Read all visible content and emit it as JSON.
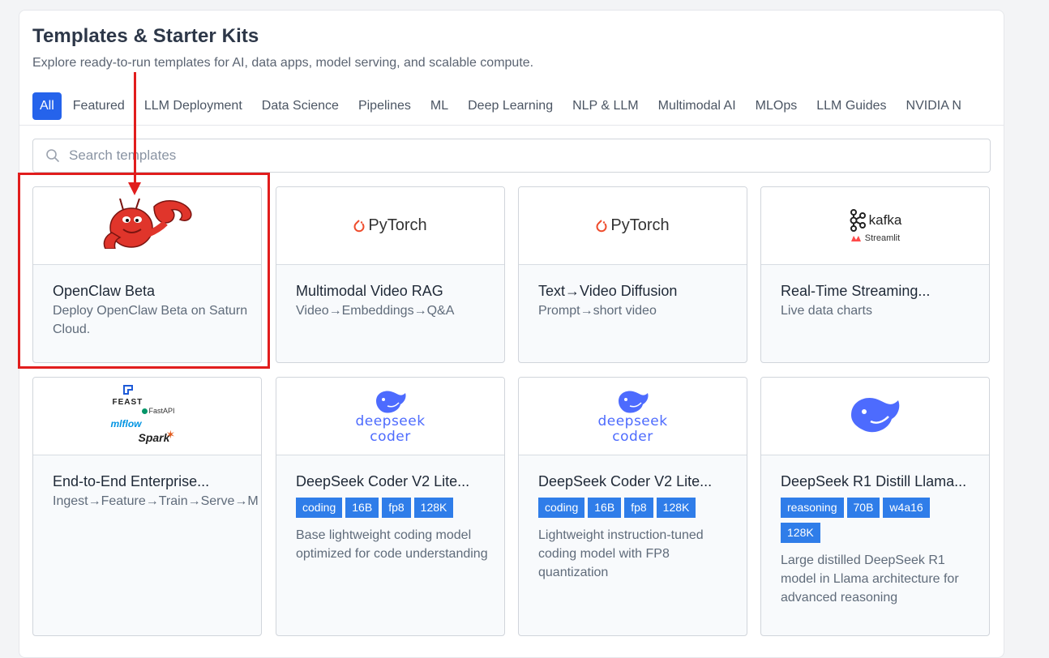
{
  "header": {
    "title": "Templates & Starter Kits",
    "subtitle": "Explore ready-to-run templates for AI, data apps, model serving, and scalable compute."
  },
  "tabs": [
    {
      "label": "All"
    },
    {
      "label": "Featured"
    },
    {
      "label": "LLM Deployment"
    },
    {
      "label": "Data Science"
    },
    {
      "label": "Pipelines"
    },
    {
      "label": "ML"
    },
    {
      "label": "Deep Learning"
    },
    {
      "label": "NLP & LLM"
    },
    {
      "label": "Multimodal AI"
    },
    {
      "label": "MLOps"
    },
    {
      "label": "LLM Guides"
    },
    {
      "label": "NVIDIA N"
    }
  ],
  "search": {
    "placeholder": "Search templates"
  },
  "cards": [
    {
      "title": "OpenClaw Beta",
      "description": "Deploy OpenClaw Beta on Saturn Cloud.",
      "logo": "lobster-logo"
    },
    {
      "title": "Multimodal Video RAG",
      "description": "Video→Embeddings→Q&A",
      "logo": "pytorch-logo",
      "logo_text": "PyTorch"
    },
    {
      "title": "Text→Video Diffusion",
      "description": "Prompt→short video",
      "logo": "pytorch-logo",
      "logo_text": "PyTorch"
    },
    {
      "title": "Real-Time Streaming...",
      "description": "Live data charts",
      "logo": "kafka-streamlit-logo",
      "logo_text": "kafka",
      "logo_subtext": "Streamlit"
    },
    {
      "title": "End-to-End Enterprise...",
      "description": "Ingest→Feature→Train→Serve→M",
      "logo": "feast-fastapi-mlflow-spark-logo",
      "logo_texts": [
        "FEAST",
        "FastAPI",
        "mlflow",
        "Spark"
      ]
    },
    {
      "title": "DeepSeek Coder V2 Lite...",
      "tags": [
        "coding",
        "16B",
        "fp8",
        "128K"
      ],
      "description": "Base lightweight coding model optimized for code understanding",
      "logo": "deepseek-coder-logo",
      "logo_texts": [
        "deepseek",
        "coder"
      ]
    },
    {
      "title": "DeepSeek Coder V2 Lite...",
      "tags": [
        "coding",
        "16B",
        "fp8",
        "128K"
      ],
      "description": "Lightweight instruction-tuned coding model with FP8 quantization",
      "logo": "deepseek-coder-logo",
      "logo_texts": [
        "deepseek",
        "coder"
      ]
    },
    {
      "title": "DeepSeek R1 Distill Llama...",
      "tags": [
        "reasoning",
        "70B",
        "w4a16",
        "128K"
      ],
      "description": "Large distilled DeepSeek R1 model in Llama architecture for advanced reasoning",
      "logo": "deepseek-whale-logo"
    }
  ],
  "colors": {
    "accent": "#2563eb",
    "tag": "#2f7de9",
    "annotation": "#e11d1d",
    "deepseek": "#4d6bfe"
  }
}
